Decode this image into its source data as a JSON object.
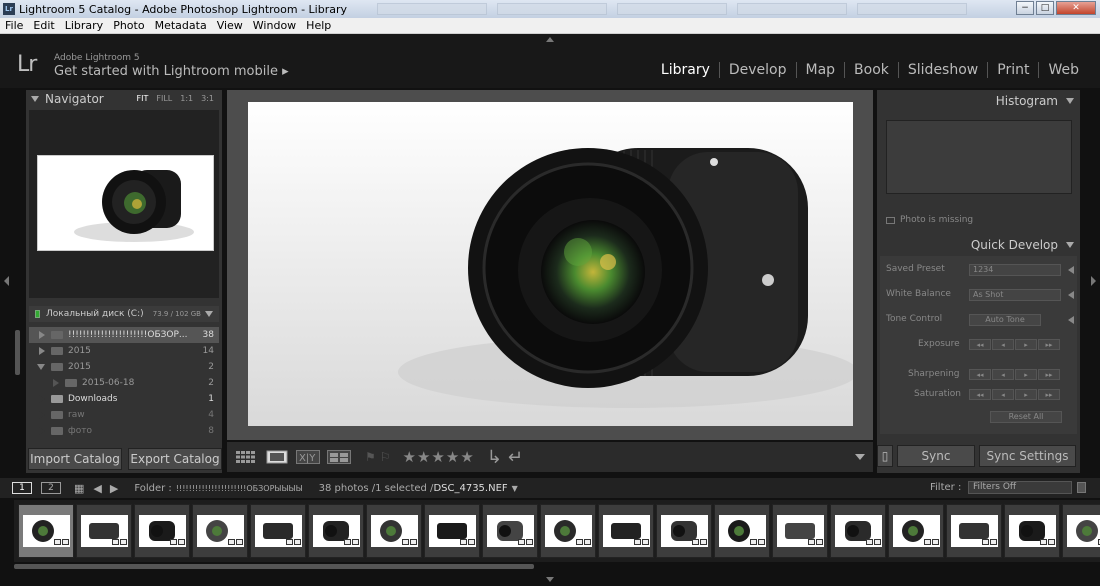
{
  "window": {
    "title": "Lightroom 5 Catalog - Adobe Photoshop Lightroom - Library",
    "minimize": "−",
    "maximize": "□",
    "close": "✕"
  },
  "menubar": [
    "File",
    "Edit",
    "Library",
    "Photo",
    "Metadata",
    "View",
    "Window",
    "Help"
  ],
  "identity": {
    "logo": "Lr",
    "product": "Adobe Lightroom 5",
    "mobile": "Get started with Lightroom mobile ▸"
  },
  "modules": [
    "Library",
    "Develop",
    "Map",
    "Book",
    "Slideshow",
    "Print",
    "Web"
  ],
  "navigator": {
    "title": "Navigator",
    "zoom": [
      "FIT",
      "FILL",
      "1:1",
      "3:1"
    ]
  },
  "volume": {
    "name": "Локальный диск (C:)",
    "capacity": "73.9 / 102 GB"
  },
  "folders": [
    {
      "name": "!!!!!!!!!!!!!!!!!!!!!!ОБЗОР...",
      "count": "38",
      "selected": true,
      "expanded": false,
      "indent": 0
    },
    {
      "name": "2015",
      "count": "14",
      "selected": false,
      "expanded": false,
      "indent": 0
    },
    {
      "name": "2015",
      "count": "2",
      "selected": false,
      "expanded": true,
      "indent": 0
    },
    {
      "name": "2015-06-18",
      "count": "2",
      "selected": false,
      "expanded": false,
      "indent": 1
    },
    {
      "name": "Downloads",
      "count": "1",
      "selected": false,
      "expanded": false,
      "indent": 0
    },
    {
      "name": "raw",
      "count": "4",
      "selected": false,
      "expanded": false,
      "indent": 0
    },
    {
      "name": "фото",
      "count": "8",
      "selected": false,
      "expanded": false,
      "indent": 0
    }
  ],
  "left_buttons": {
    "import": "Import Catalog",
    "export": "Export Catalog"
  },
  "histogram": {
    "title": "Histogram",
    "missing": "Photo is missing"
  },
  "quick_develop": {
    "title": "Quick Develop",
    "saved_preset_label": "Saved Preset",
    "saved_preset_value": "1234",
    "white_balance_label": "White Balance",
    "white_balance_value": "As Shot",
    "tone_control_label": "Tone Control",
    "auto_tone": "Auto Tone",
    "exposure_label": "Exposure",
    "sharpening_label": "Sharpening",
    "saturation_label": "Saturation",
    "reset_all": "Reset All"
  },
  "right_buttons": {
    "sync": "Sync",
    "sync_settings": "Sync Settings"
  },
  "filmbar": {
    "page1": "1",
    "page2": "2",
    "folder_label": "Folder :",
    "folder_name": "!!!!!!!!!!!!!!!!!!!!!!ОБЗОРЫЫЫЫ",
    "count": "38 photos /1 selected /",
    "filename": "DSC_4735.NEF",
    "filter_label": "Filter :",
    "filter_value": "Filters Off"
  },
  "toolbar": {
    "stars": "★★★★★"
  },
  "filmstrip_count": 19
}
